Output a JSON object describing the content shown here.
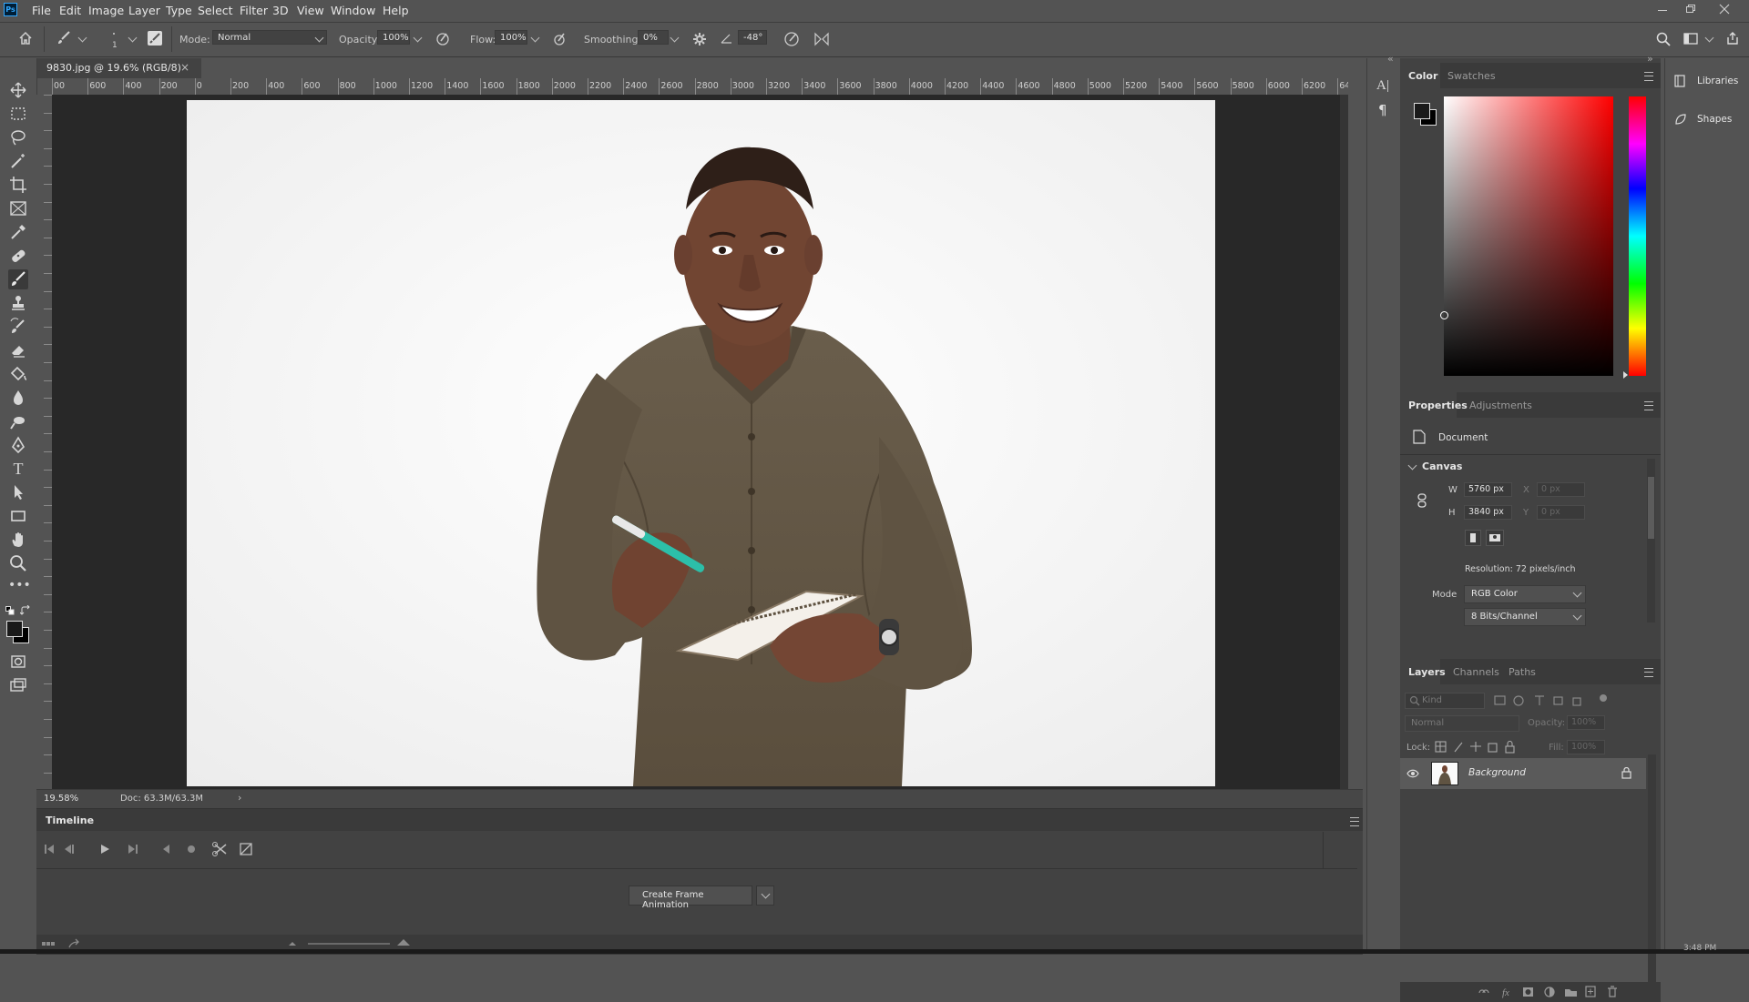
{
  "menubar": {
    "logo": "Ps",
    "items": [
      "File",
      "Edit",
      "Image",
      "Layer",
      "Type",
      "Select",
      "Filter",
      "3D",
      "View",
      "Window",
      "Help"
    ]
  },
  "options": {
    "brush_size": "1",
    "mode_label": "Mode:",
    "mode_value": "Normal",
    "opacity_label": "Opacity:",
    "opacity_value": "100%",
    "flow_label": "Flow:",
    "flow_value": "100%",
    "smoothing_label": "Smoothing:",
    "smoothing_value": "0%",
    "angle_value": "-48°"
  },
  "document": {
    "tab_title": "9830.jpg @ 19.6% (RGB/8)",
    "ruler_labels": [
      "00",
      "600",
      "400",
      "200",
      "0",
      "200",
      "400",
      "600",
      "800",
      "1000",
      "1200",
      "1400",
      "1600",
      "1800",
      "2000",
      "2200",
      "2400",
      "2600",
      "2800",
      "3000",
      "3200",
      "3400",
      "3600",
      "3800",
      "4000",
      "4200",
      "4400",
      "4600",
      "4800",
      "5000",
      "5200",
      "5400",
      "5600",
      "5800",
      "6000",
      "6200",
      "6400"
    ],
    "zoom": "19.58%",
    "doc_size": "Doc: 63.3M/63.3M"
  },
  "timeline": {
    "title": "Timeline",
    "create_button": "Create Frame Animation"
  },
  "color_panel": {
    "tabs": [
      "Color",
      "Swatches"
    ]
  },
  "properties": {
    "tabs": [
      "Properties",
      "Adjustments"
    ],
    "doc_label": "Document",
    "canvas_label": "Canvas",
    "w_label": "W",
    "w_value": "5760 px",
    "h_label": "H",
    "h_value": "3840 px",
    "x_label": "X",
    "x_placeholder": "0 px",
    "y_label": "Y",
    "y_placeholder": "0 px",
    "resolution": "Resolution: 72 pixels/inch",
    "mode_label": "Mode",
    "mode_value": "RGB Color",
    "depth_value": "8 Bits/Channel"
  },
  "layers": {
    "tabs": [
      "Layers",
      "Channels",
      "Paths"
    ],
    "kind_placeholder": "Kind",
    "blend_mode": "Normal",
    "opacity_label": "Opacity:",
    "opacity_value": "100%",
    "lock_label": "Lock:",
    "fill_label": "Fill:",
    "fill_value": "100%",
    "layer_name": "Background"
  },
  "right_col": {
    "libraries": "Libraries",
    "shapes": "Shapes"
  },
  "clock": "3:48 PM",
  "colors": {
    "accent": "#31a8ff",
    "ui_bg": "#535353",
    "panel_bg": "#424242"
  }
}
